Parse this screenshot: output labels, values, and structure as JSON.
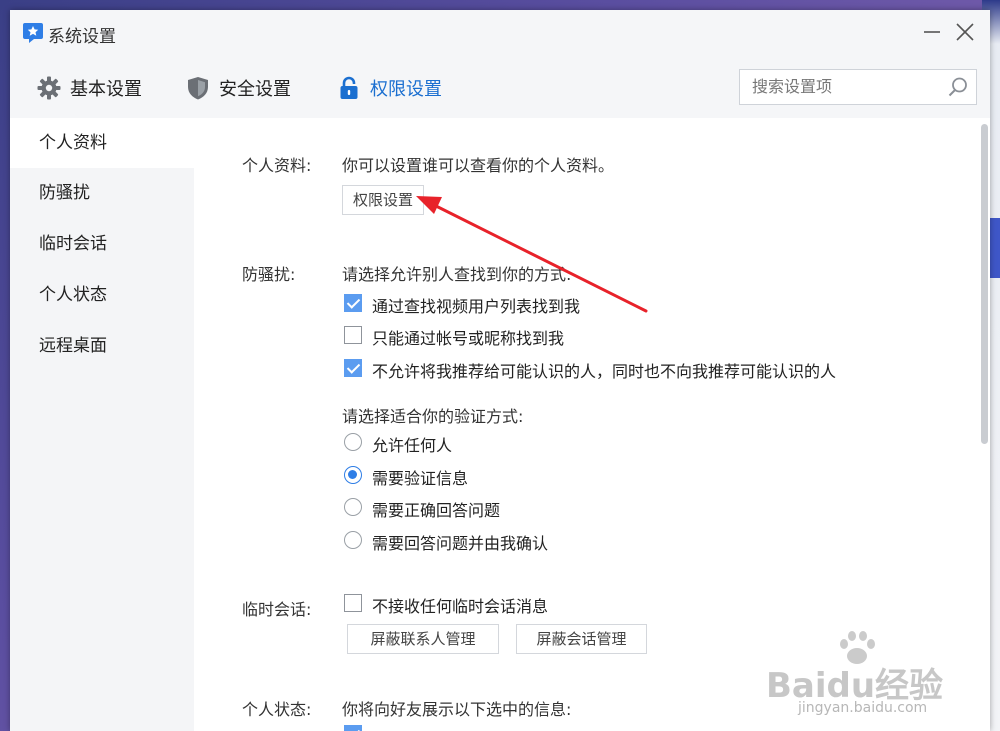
{
  "window": {
    "title": "系统设置"
  },
  "icons": {
    "logo": "star-chat-icon",
    "minimize": "minimize-icon",
    "close": "close-icon",
    "search": "search-icon",
    "basic": "gear-icon",
    "security": "shield-icon",
    "permission": "lock-icon"
  },
  "tabs": {
    "basic": "基本设置",
    "security": "安全设置",
    "permission": "权限设置",
    "active": "权限设置"
  },
  "search": {
    "placeholder": "搜索设置项",
    "value": ""
  },
  "sidebar": {
    "items": [
      {
        "label": "个人资料",
        "active": true
      },
      {
        "label": "防骚扰",
        "active": false
      },
      {
        "label": "临时会话",
        "active": false
      },
      {
        "label": "个人状态",
        "active": false
      },
      {
        "label": "远程桌面",
        "active": false
      }
    ]
  },
  "profile": {
    "label": "个人资料:",
    "desc": "你可以设置谁可以查看你的个人资料。",
    "button": "权限设置"
  },
  "harassment": {
    "label": "防骚扰:",
    "find_prompt": "请选择允许别人查找到你的方式:",
    "find_options": [
      {
        "label": "通过查找视频用户列表找到我",
        "checked": true
      },
      {
        "label": "只能通过帐号或昵称找到我",
        "checked": false
      },
      {
        "label": "不允许将我推荐给可能认识的人，同时也不向我推荐可能认识的人",
        "checked": true
      }
    ],
    "verify_prompt": "请选择适合你的验证方式:",
    "verify_options": [
      {
        "label": "允许任何人",
        "selected": false
      },
      {
        "label": "需要验证信息",
        "selected": true
      },
      {
        "label": "需要正确回答问题",
        "selected": false
      },
      {
        "label": "需要回答问题并由我确认",
        "selected": false
      }
    ]
  },
  "temp_session": {
    "label": "临时会话:",
    "option": {
      "label": "不接收任何临时会话消息",
      "checked": false
    },
    "buttons": [
      "屏蔽联系人管理",
      "屏蔽会话管理"
    ]
  },
  "status": {
    "label": "个人状态:",
    "desc": "你将向好友展示以下选中的信息:"
  },
  "watermark": {
    "brand": "Baidu经验",
    "url": "jingyan.baidu.com"
  },
  "colors": {
    "accent": "#1b6fd0",
    "checkbox": "#5b9cf0",
    "annotation_arrow": "#e8222a"
  }
}
